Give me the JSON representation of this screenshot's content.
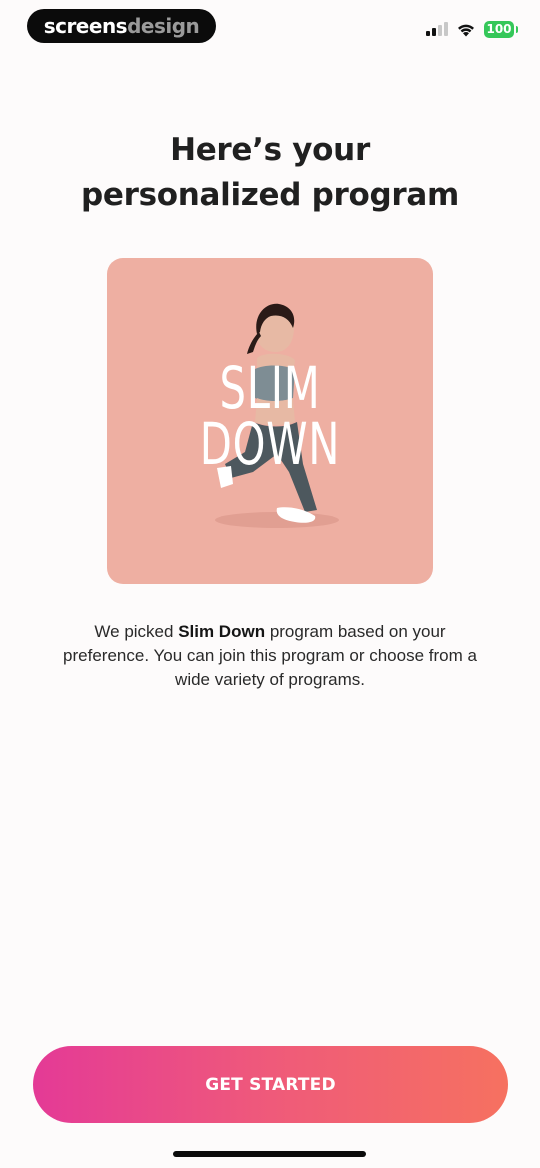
{
  "brand": {
    "part1": "screens",
    "part2": "design"
  },
  "status_bar": {
    "signal_icon": "cellular-signal-icon",
    "wifi_icon": "wifi-icon",
    "battery_level": "100",
    "battery_color": "#35c759"
  },
  "header": {
    "title_line1": "Here’s your",
    "title_line2": "personalized program"
  },
  "program_card": {
    "background_color": "#eeafa2",
    "title_line1": "SLIM",
    "title_line2": "DOWN",
    "image": "woman-lunge-photo"
  },
  "description": {
    "prefix": "We picked ",
    "program_name": "Slim Down",
    "suffix": " program based on your preference. You can join this program or choose from a wide variety of programs."
  },
  "cta": {
    "label": "GET STARTED",
    "gradient_start": "#e43a96",
    "gradient_end": "#f67160"
  }
}
